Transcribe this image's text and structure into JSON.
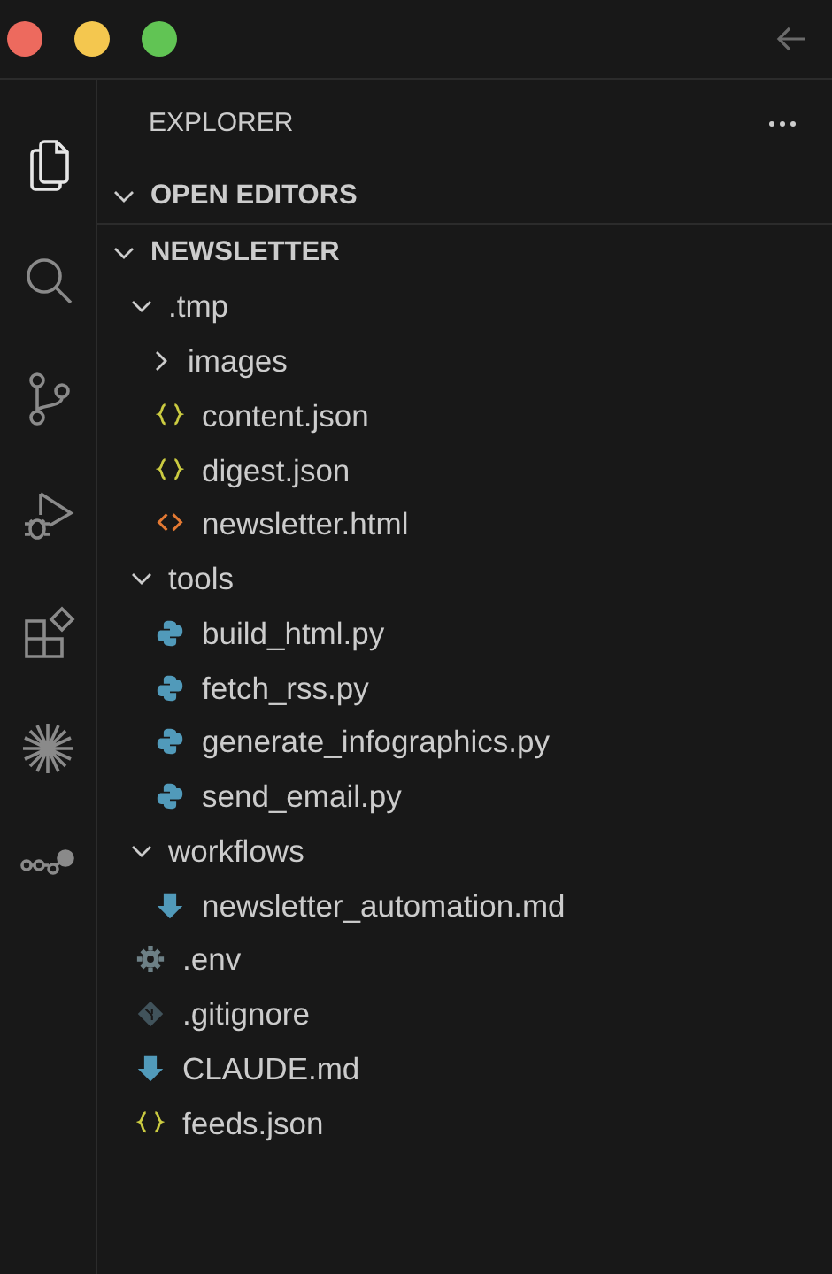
{
  "activity_bar": [
    {
      "kind": "files",
      "selected": true
    },
    {
      "kind": "search",
      "selected": false
    },
    {
      "kind": "source-control",
      "selected": false
    },
    {
      "kind": "run-debug",
      "selected": false
    },
    {
      "kind": "extensions",
      "selected": false
    },
    {
      "kind": "burst",
      "selected": false
    },
    {
      "kind": "flow",
      "selected": false
    }
  ],
  "sidebar": {
    "title": "EXPLORER",
    "sections": [
      {
        "title": "OPEN EDITORS",
        "expanded": true
      },
      {
        "title": "NEWSLETTER",
        "expanded": true,
        "items": [
          {
            "name": ".tmp",
            "kind": "folder",
            "expanded": true,
            "children": [
              {
                "name": "images",
                "kind": "folder",
                "expanded": false
              },
              {
                "name": "content.json",
                "kind": "json"
              },
              {
                "name": "digest.json",
                "kind": "json"
              },
              {
                "name": "newsletter.html",
                "kind": "html"
              }
            ]
          },
          {
            "name": "tools",
            "kind": "folder",
            "expanded": true,
            "children": [
              {
                "name": "build_html.py",
                "kind": "python"
              },
              {
                "name": "fetch_rss.py",
                "kind": "python"
              },
              {
                "name": "generate_infographics.py",
                "kind": "python"
              },
              {
                "name": "send_email.py",
                "kind": "python"
              }
            ]
          },
          {
            "name": "workflows",
            "kind": "folder",
            "expanded": true,
            "children": [
              {
                "name": "newsletter_automation.md",
                "kind": "markdown"
              }
            ]
          },
          {
            "name": ".env",
            "kind": "settings"
          },
          {
            "name": ".gitignore",
            "kind": "git"
          },
          {
            "name": "CLAUDE.md",
            "kind": "markdown"
          },
          {
            "name": "feeds.json",
            "kind": "json"
          }
        ]
      }
    ]
  }
}
